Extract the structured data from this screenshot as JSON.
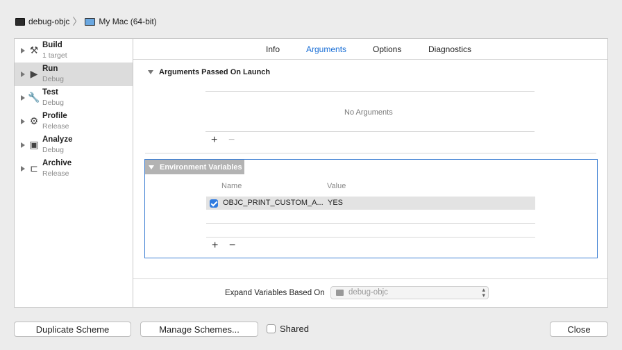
{
  "breadcrumb": {
    "scheme": "debug-objc",
    "destination": "My Mac (64-bit)"
  },
  "sidebar": {
    "items": [
      {
        "title": "Build",
        "sub": "1 target",
        "icon": "hammer-icon",
        "glyph": "⚒"
      },
      {
        "title": "Run",
        "sub": "Debug",
        "icon": "play-icon",
        "glyph": "▶"
      },
      {
        "title": "Test",
        "sub": "Debug",
        "icon": "wrench-icon",
        "glyph": "🔧"
      },
      {
        "title": "Profile",
        "sub": "Release",
        "icon": "instruments-icon",
        "glyph": "⚙"
      },
      {
        "title": "Analyze",
        "sub": "Debug",
        "icon": "analyze-icon",
        "glyph": "▣"
      },
      {
        "title": "Archive",
        "sub": "Release",
        "icon": "archive-icon",
        "glyph": "⊏"
      }
    ],
    "selected_index": 1
  },
  "tabs": [
    {
      "label": "Info"
    },
    {
      "label": "Arguments"
    },
    {
      "label": "Options"
    },
    {
      "label": "Diagnostics"
    }
  ],
  "active_tab": "Arguments",
  "arguments": {
    "title": "Arguments Passed On Launch",
    "empty_text": "No Arguments"
  },
  "environment": {
    "title": "Environment Variables",
    "col_name": "Name",
    "col_value": "Value",
    "rows": [
      {
        "name": "OBJC_PRINT_CUSTOM_A...",
        "value": "YES",
        "enabled": true
      }
    ]
  },
  "plus": "+",
  "minus": "−",
  "footer": {
    "expand_label": "Expand Variables Based On",
    "expand_value": "debug-objc"
  },
  "buttons": {
    "duplicate": "Duplicate Scheme",
    "manage": "Manage Schemes...",
    "shared": "Shared",
    "close": "Close"
  },
  "colors": {
    "accent": "#1a6fd6",
    "selection": "#dcdcdc",
    "focus_border": "#3d7fd3"
  }
}
